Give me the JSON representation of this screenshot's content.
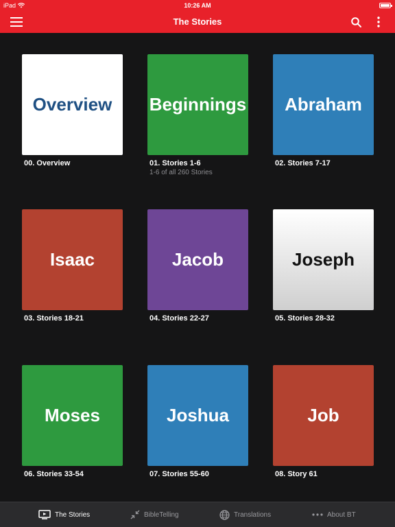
{
  "status": {
    "carrier": "iPad",
    "time": "10:26 AM"
  },
  "navbar": {
    "title": "The Stories"
  },
  "icons": {
    "menu": "hamburger-menu-icon",
    "search": "search-icon",
    "more": "vertical-ellipsis-icon"
  },
  "stories": [
    {
      "tile": "Overview",
      "caption": "00. Overview",
      "subcaption": "",
      "bg": "#ffffff",
      "fg": "#1f5083"
    },
    {
      "tile": "Beginnings",
      "caption": "01. Stories 1-6",
      "subcaption": "1-6 of all 260 Stories",
      "bg": "#2e9a3f",
      "fg": "#ffffff"
    },
    {
      "tile": "Abraham",
      "caption": "02. Stories 7-17",
      "subcaption": "",
      "bg": "#2f7fb8",
      "fg": "#ffffff"
    },
    {
      "tile": "Isaac",
      "caption": "03. Stories 18-21",
      "subcaption": "",
      "bg": "#b34230",
      "fg": "#ffffff"
    },
    {
      "tile": "Jacob",
      "caption": "04. Stories 22-27",
      "subcaption": "",
      "bg": "#6e4696",
      "fg": "#ffffff"
    },
    {
      "tile": "Joseph",
      "caption": "05. Stories 28-32",
      "subcaption": "",
      "bg": "#e6e6e6",
      "fg": "#111111"
    },
    {
      "tile": "Moses",
      "caption": "06. Stories 33-54",
      "subcaption": "",
      "bg": "#2e9a3f",
      "fg": "#ffffff"
    },
    {
      "tile": "Joshua",
      "caption": "07. Stories 55-60",
      "subcaption": "",
      "bg": "#2f7fb8",
      "fg": "#ffffff"
    },
    {
      "tile": "Job",
      "caption": "08. Story 61",
      "subcaption": "",
      "bg": "#b34230",
      "fg": "#ffffff"
    }
  ],
  "tabs": [
    {
      "label": "The Stories",
      "icon": "tv-icon",
      "active": true
    },
    {
      "label": "BibleTelling",
      "icon": "collapse-icon",
      "active": false
    },
    {
      "label": "Translations",
      "icon": "globe-icon",
      "active": false
    },
    {
      "label": "About BT",
      "icon": "ellipsis-icon",
      "active": false
    }
  ]
}
